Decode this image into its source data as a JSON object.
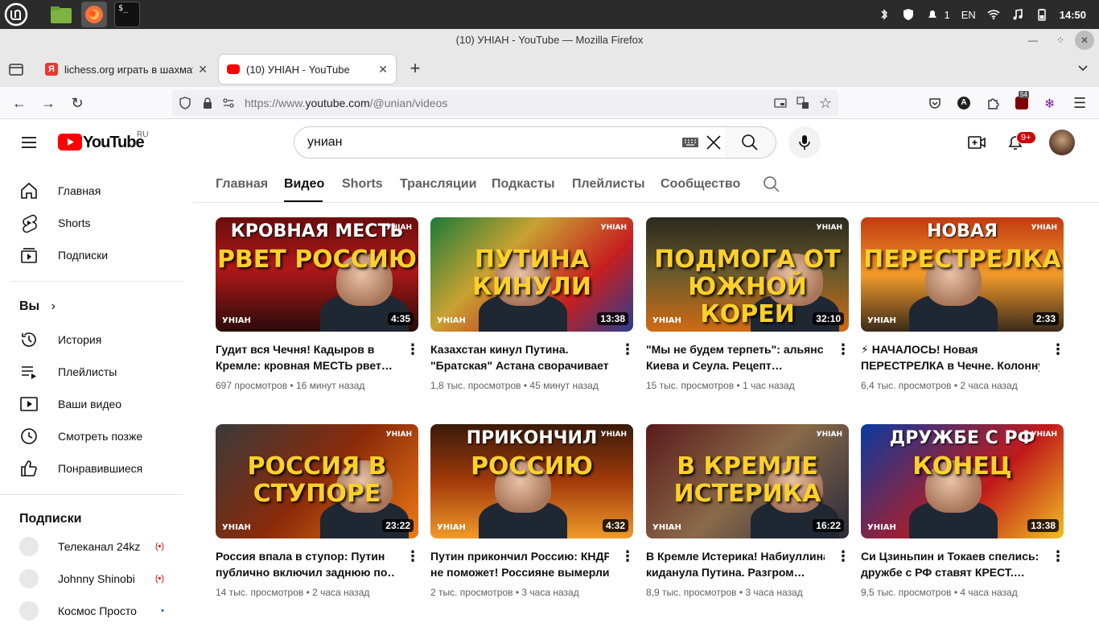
{
  "os": {
    "keyboard_layout": "EN",
    "notification_count": "1",
    "clock": "14:50",
    "icons": [
      "linux-mint-menu-icon",
      "files-folder-icon",
      "firefox-icon",
      "terminal-icon",
      "bluetooth-icon",
      "shield-update-icon",
      "notifications-icon",
      "wifi-icon",
      "music-icon",
      "battery-icon"
    ],
    "terminal_glyph": "$_"
  },
  "window": {
    "title": "(10) УНІАН - YouTube — Mozilla Firefox"
  },
  "tabs": [
    {
      "label": "lichess.org играть в шахмат",
      "favicon_color": "#e53935",
      "favicon_glyph": "Я"
    },
    {
      "label": "(10) УНІАН - YouTube",
      "favicon_color": "#ff0000",
      "active": true
    }
  ],
  "navbar": {
    "url_scheme": "https://www.",
    "url_host": "youtube.com",
    "url_path": "/@unian/videos",
    "ublock_count": "54"
  },
  "youtube": {
    "logo_text": "YouTube",
    "region": "RU",
    "search_value": "униан",
    "notification_badge": "9+"
  },
  "sidebar": {
    "main": [
      {
        "label": "Главная",
        "icon": "home-icon"
      },
      {
        "label": "Shorts",
        "icon": "shorts-icon"
      },
      {
        "label": "Подписки",
        "icon": "subscriptions-icon"
      }
    ],
    "you_header": "Вы",
    "you": [
      {
        "label": "История",
        "icon": "history-icon"
      },
      {
        "label": "Плейлисты",
        "icon": "playlists-icon"
      },
      {
        "label": "Ваши видео",
        "icon": "your-videos-icon"
      },
      {
        "label": "Смотреть позже",
        "icon": "watch-later-icon"
      },
      {
        "label": "Понравившиеся",
        "icon": "liked-icon"
      }
    ],
    "subs_header": "Подписки",
    "subs": [
      {
        "label": "Телеканал 24kz",
        "live": "(•)"
      },
      {
        "label": "Johnny Shinobi",
        "live": "(•)"
      },
      {
        "label": "Космос Просто",
        "live": "•"
      }
    ]
  },
  "channel_tabs": [
    "Главная",
    "Видео",
    "Shorts",
    "Трансляции",
    "Подкасты",
    "Плейлисты",
    "Сообщество"
  ],
  "videos": [
    {
      "thumb_line1": "КРОВНАЯ МЕСТЬ",
      "thumb_line2": "РВЕТ РОССИЮ",
      "watermark": "УНІАН",
      "duration": "4:35",
      "title_line1": "Гудит вся Чечня! Кадыров в",
      "title_line2": "Кремле: кровная МЕСТЬ рвет…",
      "views": "697 просмотров",
      "age": "16 минут назад",
      "bg": "linear-gradient(180deg,#6a0d0d 0%,#b01818 45%,#2a0a0a 100%)"
    },
    {
      "thumb_line1": "",
      "thumb_line2": "ПУТИНА КИНУЛИ",
      "watermark": "УНІАН",
      "duration": "13:38",
      "title_line1": "Казахстан кинул Путина.",
      "title_line2": "\"Братская\" Астана сворачивает…",
      "views": "1,8 тыс. просмотров",
      "age": "45 минут назад",
      "bg": "linear-gradient(135deg,#1b7a3a 0%,#c8a232 35%,#c71f1f 70%,#2a3d8f 100%)"
    },
    {
      "thumb_line1": "",
      "thumb_line2": "ПОДМОГА ОТ ЮЖНОЙ КОРЕИ",
      "watermark": "УНІАН",
      "duration": "32:10",
      "title_line1": "\"Мы не будем терпеть\": альянс",
      "title_line2": "Киева и Сеула. Рецепт…",
      "views": "15 тыс. просмотров",
      "age": "1 час назад",
      "bg": "linear-gradient(180deg,#2b2a1f 0%,#6b5a2a 50%,#d06a14 100%)"
    },
    {
      "thumb_line1": "НОВАЯ",
      "thumb_line2": "ПЕРЕСТРЕЛКА",
      "watermark": "УНІАН",
      "duration": "2:33",
      "title_line1": "⚡ НАЧАЛОСЬ! Новая",
      "title_line2": "ПЕРЕСТРЕЛКА в Чечне. Колонну…",
      "views": "6,4 тыс. просмотров",
      "age": "2 часа назад",
      "bg": "linear-gradient(180deg,#c23a10 0%,#f29a2a 50%,#3a2a1a 100%)"
    },
    {
      "thumb_line1": "",
      "thumb_line2": "РОССИЯ В СТУПОРЕ",
      "watermark": "УНІАН",
      "duration": "23:22",
      "title_line1": "Россия впала в ступор: Путин",
      "title_line2": "публично включил заднюю по…",
      "views": "14 тыс. просмотров",
      "age": "2 часа назад",
      "bg": "linear-gradient(135deg,#3a3a3a 0%,#8a2a0a 50%,#f07a14 100%)"
    },
    {
      "thumb_line1": "ПРИКОНЧИЛ",
      "thumb_line2": "РОССИЮ",
      "watermark": "УНІАН",
      "duration": "4:32",
      "title_line1": "Путин прикончил Россию: КНДР",
      "title_line2": "не поможет! Россияне вымерли…",
      "views": "2 тыс. просмотров",
      "age": "3 часа назад",
      "bg": "linear-gradient(180deg,#3a1a0a 0%,#a33a0a 50%,#f09a2a 100%)"
    },
    {
      "thumb_line1": "",
      "thumb_line2": "В КРЕМЛЕ ИСТЕРИКА",
      "watermark": "УНІАН",
      "duration": "16:22",
      "title_line1": "В Кремле Истерика! Набиуллина",
      "title_line2": "киданула Путина. Разгром…",
      "views": "8,9 тыс. просмотров",
      "age": "3 часа назад",
      "bg": "linear-gradient(135deg,#5a1a1a 0%,#8a6a4a 50%,#2a2a3a 100%)"
    },
    {
      "thumb_line1": "ДРУЖБЕ С РФ",
      "thumb_line2": "КОНЕЦ",
      "watermark": "УНІАН",
      "duration": "13:38",
      "title_line1": "Си Цзиньпин и Токаев спелись: на",
      "title_line2": "дружбе с РФ ставят КРЕСТ.…",
      "views": "9,5 тыс. просмотров",
      "age": "4 часа назад",
      "bg": "linear-gradient(135deg,#0a3aa0 0%,#c21a1a 60%,#f0c020 100%)"
    }
  ]
}
